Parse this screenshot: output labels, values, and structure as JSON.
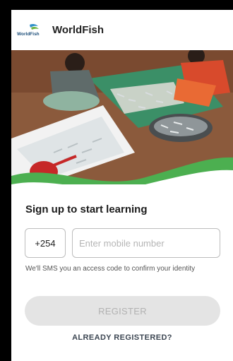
{
  "app": {
    "logo_text": "WorldFish",
    "title": "WorldFish"
  },
  "signup": {
    "heading": "Sign up to start learning",
    "country_code": "+254",
    "phone_placeholder": "Enter mobile number",
    "hint": "We'll SMS you an access code to confirm your identity",
    "register_label": "REGISTER",
    "already_registered_label": "ALREADY REGISTERED?"
  },
  "colors": {
    "accent_green": "#4caf50",
    "heading_text": "#1b1b1b",
    "disabled_button": "#e4e4e4"
  }
}
